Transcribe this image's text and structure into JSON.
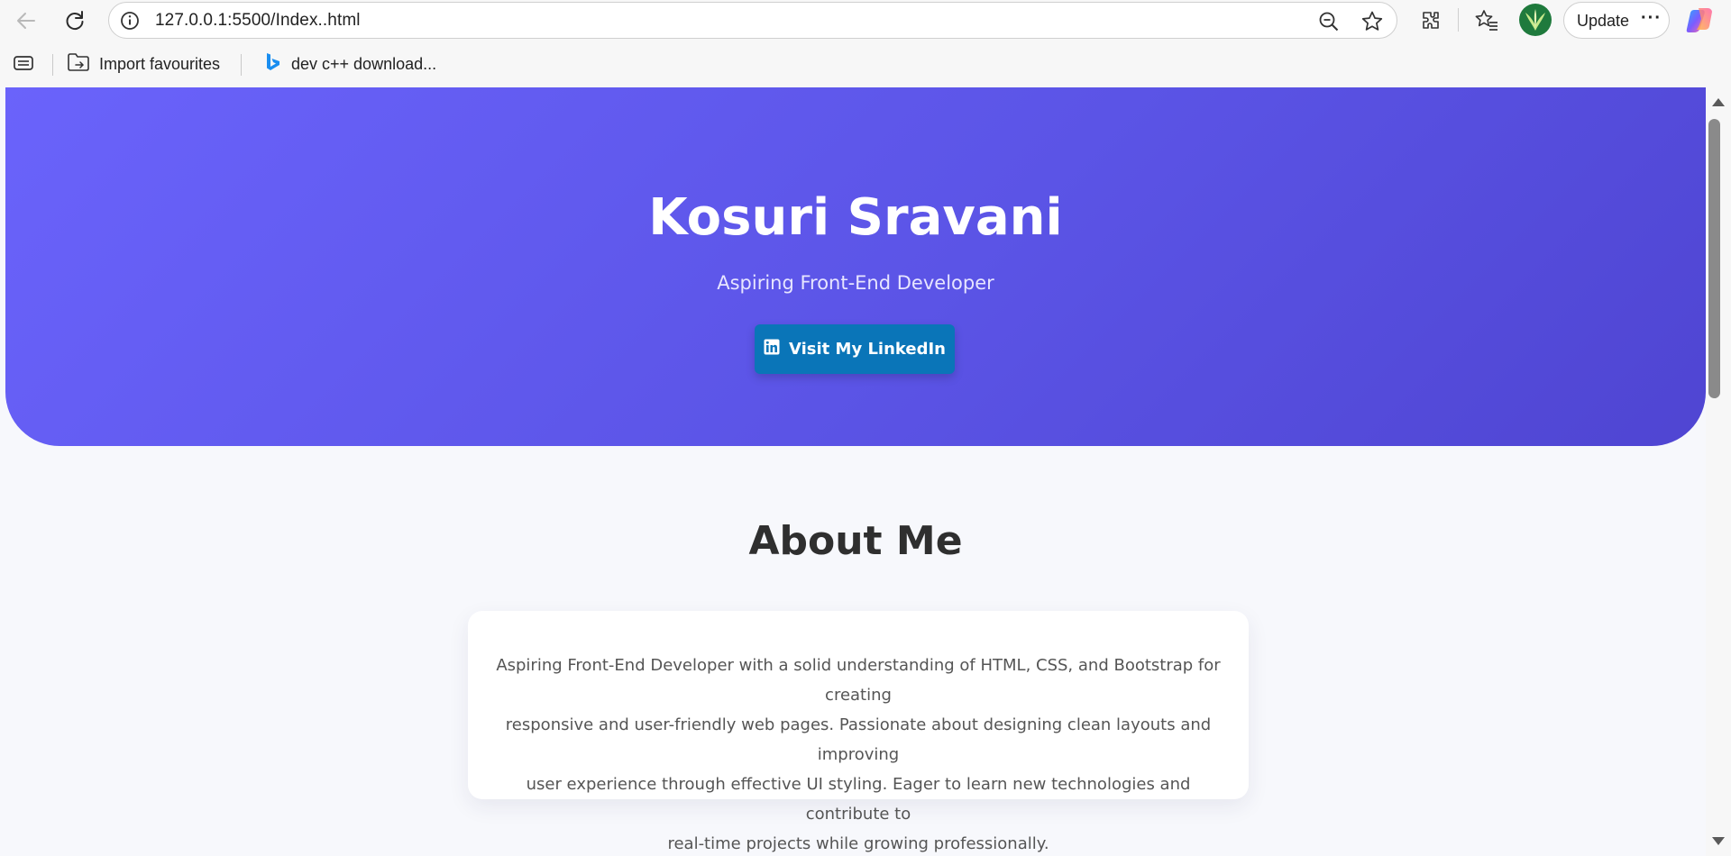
{
  "browser": {
    "url": "127.0.0.1:5500/Index..html",
    "update_label": "Update",
    "more_label": "···",
    "icons": {
      "back": "back-arrow-icon",
      "reload": "reload-icon",
      "site_info": "info-icon",
      "zoom": "zoom-out-icon",
      "favorite": "star-icon",
      "extensions": "extensions-icon",
      "favorites": "favorites-icon",
      "profile": "avatar",
      "copilot": "copilot-icon"
    }
  },
  "bookmarks": {
    "items": [
      {
        "label": "Import favourites",
        "icon": "folder-import-icon"
      },
      {
        "label": "dev c++ download...",
        "icon": "bing-icon"
      }
    ]
  },
  "hero": {
    "title": "Kosuri Sravani",
    "subtitle": "Aspiring Front-End Developer",
    "button_label": "Visit My LinkedIn",
    "button_icon": "linkedin-icon",
    "colors": {
      "gradient_start": "#6a63fb",
      "gradient_end": "#4f45d2",
      "button": "#0a75b8"
    }
  },
  "about": {
    "title": "About Me",
    "lines": [
      "Aspiring Front-End Developer with a solid understanding of HTML, CSS, and Bootstrap for creating",
      "responsive and user-friendly web pages. Passionate about designing clean layouts and improving",
      "user experience through effective UI styling. Eager to learn new technologies and contribute to",
      "real-time projects while growing professionally."
    ]
  }
}
